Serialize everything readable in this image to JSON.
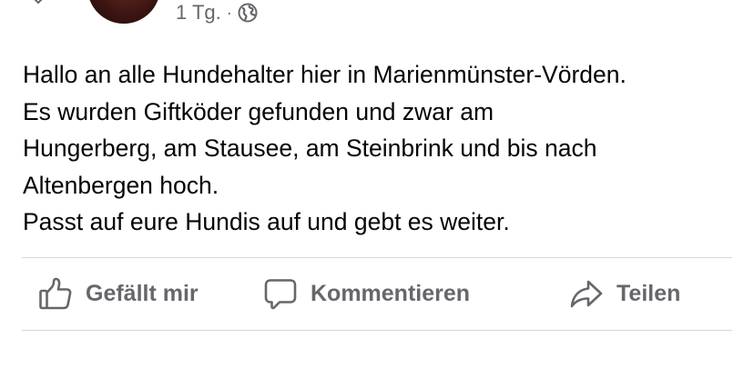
{
  "post": {
    "time": "1 Tg.",
    "separator": "·",
    "audience_icon": "globe-icon",
    "text_lines": [
      "Hallo an alle Hundehalter hier in Marienmünster-Vörden.",
      "Es wurden Giftköder gefunden und zwar am",
      "Hungerberg, am Stausee, am Steinbrink und bis nach",
      "Altenbergen hoch.",
      "Passt auf eure Hundis auf und gebt es weiter."
    ]
  },
  "actions": {
    "like": {
      "label": "Gefällt mir",
      "icon": "thumbs-up-icon"
    },
    "comment": {
      "label": "Kommentieren",
      "icon": "comment-icon"
    },
    "share": {
      "label": "Teilen",
      "icon": "share-arrow-icon"
    }
  },
  "colors": {
    "text": "#050505",
    "secondary": "#65676b",
    "divider": "#d6d7da"
  }
}
